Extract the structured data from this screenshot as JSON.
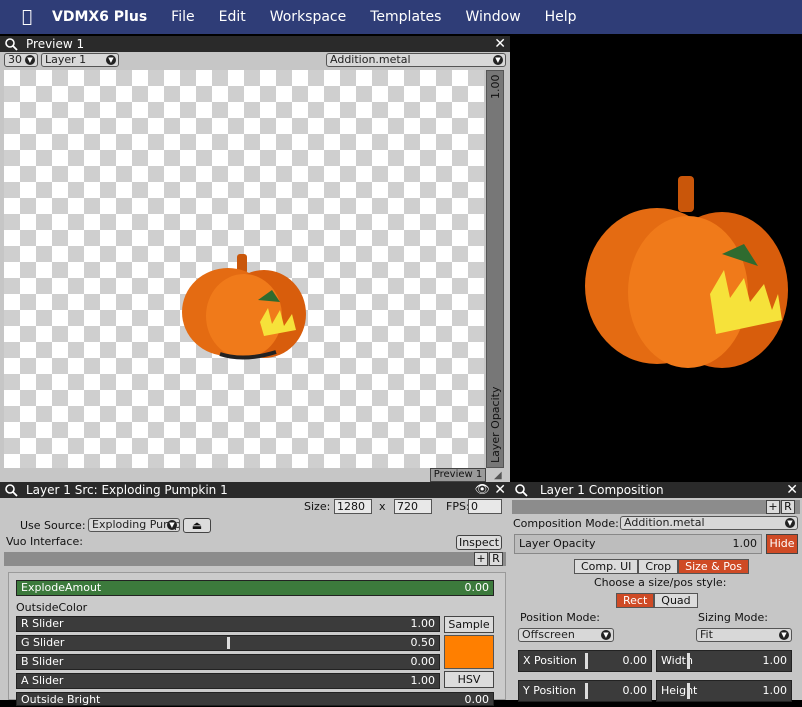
{
  "menubar": {
    "app": "VDMX6 Plus",
    "items": [
      "File",
      "Edit",
      "Workspace",
      "Templates",
      "Window",
      "Help"
    ]
  },
  "preview": {
    "title": "Preview 1",
    "fps_value": "30",
    "layer_select": "Layer 1",
    "blend_select": "Addition.metal",
    "opacity_value": "1.00",
    "opacity_label": "Layer Opacity",
    "bottom_tab": "Preview 1"
  },
  "source": {
    "title": "Layer 1 Src: Exploding Pumpkin 1",
    "size_label": "Size:",
    "width": "1280",
    "x_label": "x",
    "height": "720",
    "fps_label": "FPS:",
    "fps": "0",
    "use_source_label": "Use Source:",
    "use_source_value": "Exploding Pump",
    "vuo_label": "Vuo Interface:",
    "inspect_label": "Inspect",
    "plus_label": "+",
    "r_label": "R",
    "explode_label": "ExplodeAmout",
    "explode_value": "0.00",
    "outside_color_label": "OutsideColor",
    "sliders": [
      {
        "name": "R Slider",
        "value": "1.00",
        "level": 1.0
      },
      {
        "name": "G Slider",
        "value": "0.50",
        "level": 0.5
      },
      {
        "name": "B Slider",
        "value": "0.00",
        "level": 0.0
      },
      {
        "name": "A Slider",
        "value": "1.00",
        "level": 1.0
      }
    ],
    "sample_label": "Sample",
    "hsv_label": "HSV",
    "swatch_color": "#ff7f00",
    "bottom_row_label": "Outside Bright",
    "bottom_row_value": "0.00"
  },
  "composition": {
    "title": "Layer 1 Composition",
    "plus_label": "+",
    "r_label": "R",
    "mode_label": "Composition Mode:",
    "mode_value": "Addition.metal",
    "opacity_label": "Layer Opacity",
    "opacity_value": "1.00",
    "hide_label": "Hide",
    "tabs": [
      "Comp. UI",
      "Crop",
      "Size & Pos"
    ],
    "active_tab": "Size & Pos",
    "choose_label": "Choose a size/pos style:",
    "styles": [
      "Rect",
      "Quad"
    ],
    "active_style": "Rect",
    "position_mode_label": "Position Mode:",
    "position_mode_value": "Offscreen",
    "sizing_mode_label": "Sizing Mode:",
    "sizing_mode_value": "Fit",
    "x_position_label": "X Position",
    "x_position_value": "0.00",
    "width_label": "Width",
    "width_value": "1.00",
    "y_position_label": "Y Position",
    "y_position_value": "0.00",
    "height_label": "Height",
    "height_value": "1.00"
  },
  "colors": {
    "accent": "#cf4a25",
    "menubar": "#2f3d77",
    "green_slider": "#3c7a3c",
    "pumpkin": "#e06a10"
  }
}
